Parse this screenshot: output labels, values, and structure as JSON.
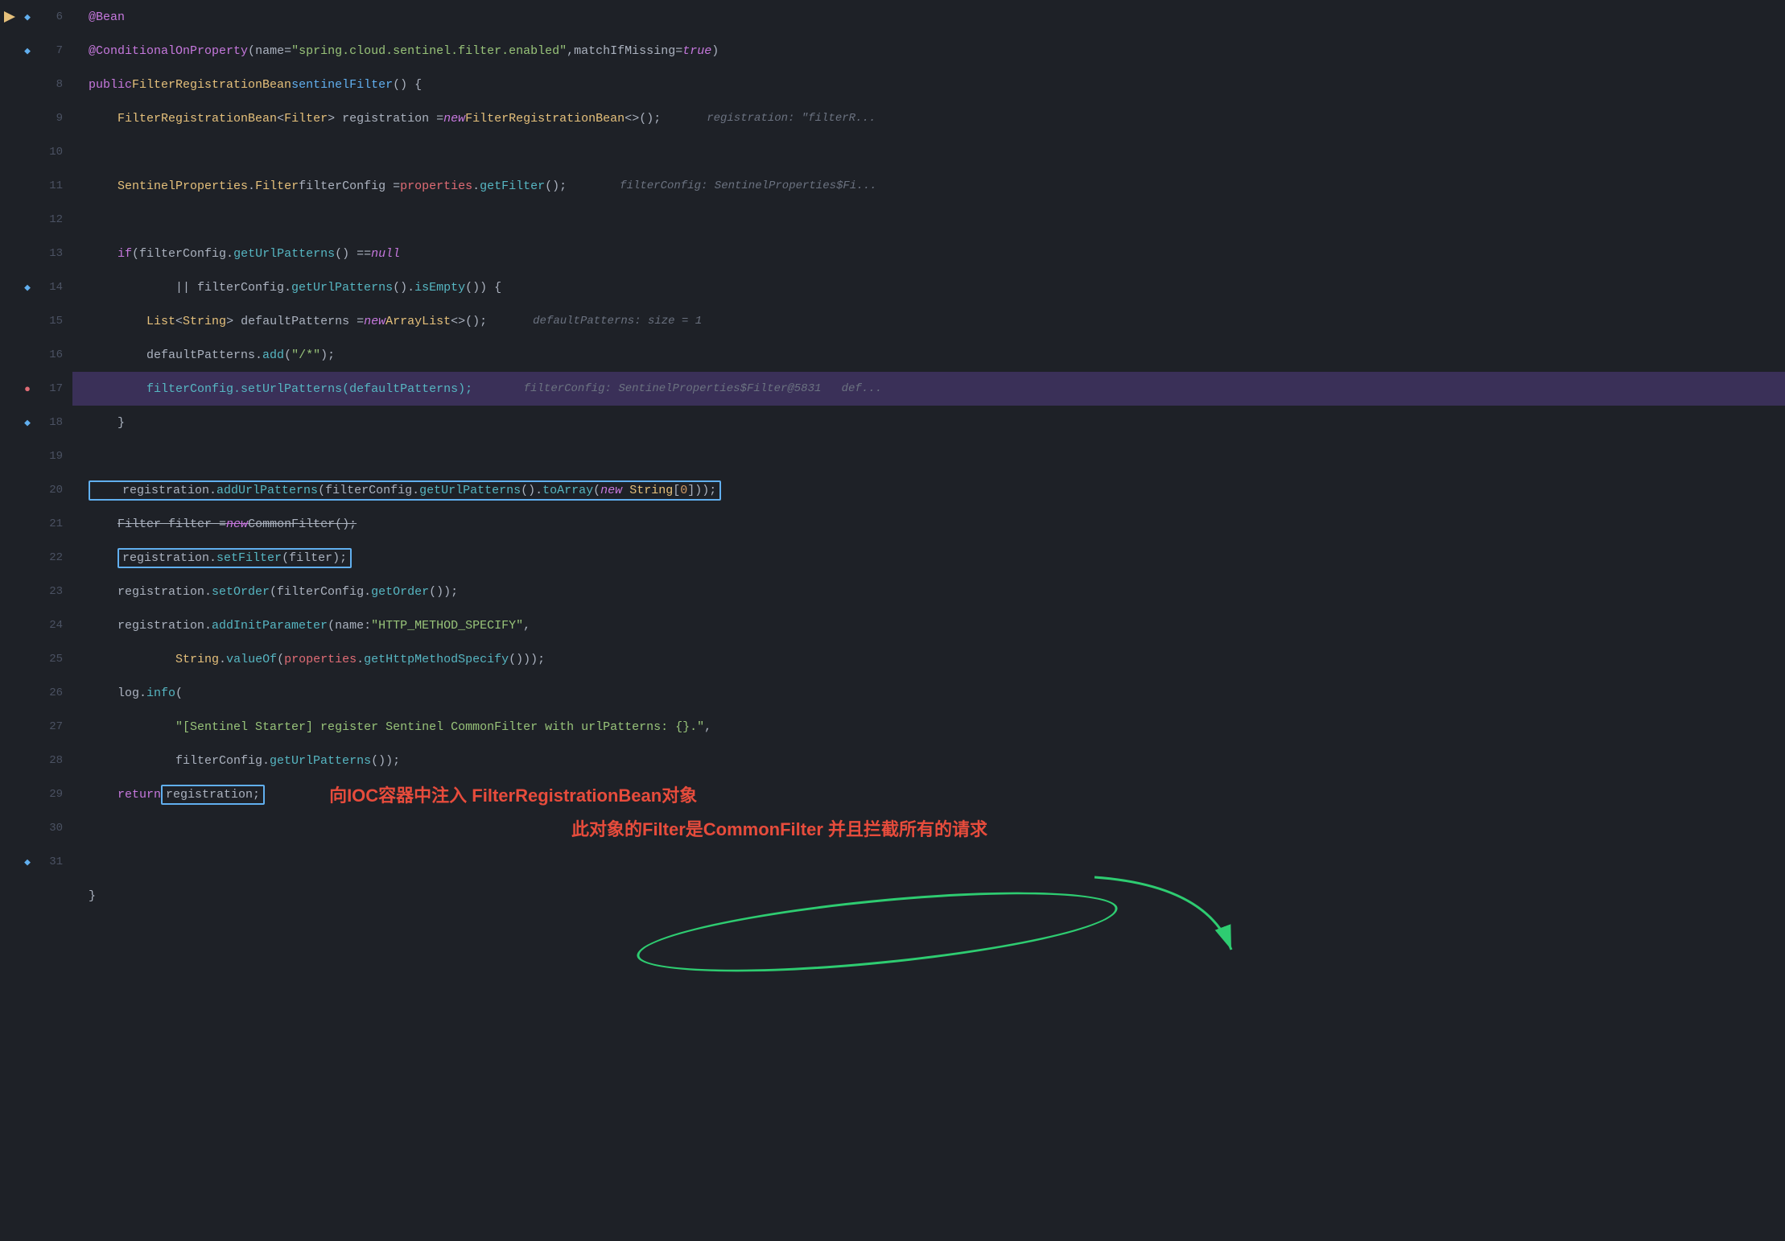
{
  "editor": {
    "background": "#1e2127",
    "lines": [
      {
        "num": 6,
        "has_bookmark": true,
        "has_bp": false,
        "highlighted": false,
        "content": "@Bean"
      },
      {
        "num": 7,
        "has_bookmark": true,
        "has_bp": false,
        "highlighted": false,
        "content": "@ConditionalOnProperty(name = \"spring.cloud.sentinel.filter.enabled\", matchIfMissing = true)"
      },
      {
        "num": 8,
        "has_bookmark": false,
        "has_bp": false,
        "highlighted": false,
        "content": "public FilterRegistrationBean sentinelFilter() {"
      },
      {
        "num": 9,
        "has_bookmark": false,
        "has_bp": false,
        "highlighted": false,
        "content": "    FilterRegistrationBean<Filter> registration = new FilterRegistrationBean<>();"
      },
      {
        "num": 10,
        "has_bookmark": false,
        "has_bp": false,
        "highlighted": false,
        "content": ""
      },
      {
        "num": 11,
        "has_bookmark": false,
        "has_bp": false,
        "highlighted": false,
        "content": "    SentinelProperties.Filter filterConfig = properties.getFilter();"
      },
      {
        "num": 12,
        "has_bookmark": false,
        "has_bp": false,
        "highlighted": false,
        "content": ""
      },
      {
        "num": 13,
        "has_bookmark": false,
        "has_bp": false,
        "highlighted": false,
        "content": "    if (filterConfig.getUrlPatterns() == null"
      },
      {
        "num": 14,
        "has_bookmark": true,
        "has_bp": false,
        "highlighted": false,
        "content": "            || filterConfig.getUrlPatterns().isEmpty()) {"
      },
      {
        "num": 15,
        "has_bookmark": false,
        "has_bp": false,
        "highlighted": false,
        "content": "        List<String> defaultPatterns = new ArrayList<>();"
      },
      {
        "num": 16,
        "has_bookmark": false,
        "has_bp": false,
        "highlighted": false,
        "content": "        defaultPatterns.add(\"/*\");"
      },
      {
        "num": 17,
        "has_bookmark": false,
        "has_bp": true,
        "highlighted": true,
        "content": "        filterConfig.setUrlPatterns(defaultPatterns);"
      },
      {
        "num": 18,
        "has_bookmark": true,
        "has_bp": false,
        "highlighted": false,
        "content": "    }"
      },
      {
        "num": 19,
        "has_bookmark": false,
        "has_bp": false,
        "highlighted": false,
        "content": ""
      },
      {
        "num": 20,
        "has_bookmark": false,
        "has_bp": false,
        "highlighted": false,
        "content": "    registration.addUrlPatterns(filterConfig.getUrlPatterns().toArray(new String[0]));"
      },
      {
        "num": 21,
        "has_bookmark": false,
        "has_bp": false,
        "highlighted": false,
        "content": "    Filter filter = new CommonFilter();"
      },
      {
        "num": 22,
        "has_bookmark": false,
        "has_bp": false,
        "highlighted": false,
        "content": "    registration.setFilter(filter);"
      },
      {
        "num": 23,
        "has_bookmark": false,
        "has_bp": false,
        "highlighted": false,
        "content": "    registration.setOrder(filterConfig.getOrder());"
      },
      {
        "num": 24,
        "has_bookmark": false,
        "has_bp": false,
        "highlighted": false,
        "content": "    registration.addInitParameter( name: \"HTTP_METHOD_SPECIFY\","
      },
      {
        "num": 25,
        "has_bookmark": false,
        "has_bp": false,
        "highlighted": false,
        "content": "            String.valueOf(properties.getHttpMethodSpecify()));"
      },
      {
        "num": 26,
        "has_bookmark": false,
        "has_bp": false,
        "highlighted": false,
        "content": "    log.info("
      },
      {
        "num": 27,
        "has_bookmark": false,
        "has_bp": false,
        "highlighted": false,
        "content": "            \"[Sentinel Starter] register Sentinel CommonFilter with urlPatterns: {}.\","
      },
      {
        "num": 28,
        "has_bookmark": false,
        "has_bp": false,
        "highlighted": false,
        "content": "            filterConfig.getUrlPatterns());"
      },
      {
        "num": 29,
        "has_bookmark": false,
        "has_bp": false,
        "highlighted": false,
        "content": "    return registration;"
      },
      {
        "num": 30,
        "has_bookmark": false,
        "has_bp": false,
        "highlighted": false,
        "content": ""
      },
      {
        "num": 31,
        "has_bookmark": true,
        "has_bp": false,
        "highlighted": false,
        "content": "}"
      }
    ],
    "annotation_text_line1": "向IOC容器中注入 FilterRegistrationBean对象",
    "annotation_text_line2": "此对象的Filter是CommonFilter 并且拦截所有的请求"
  }
}
